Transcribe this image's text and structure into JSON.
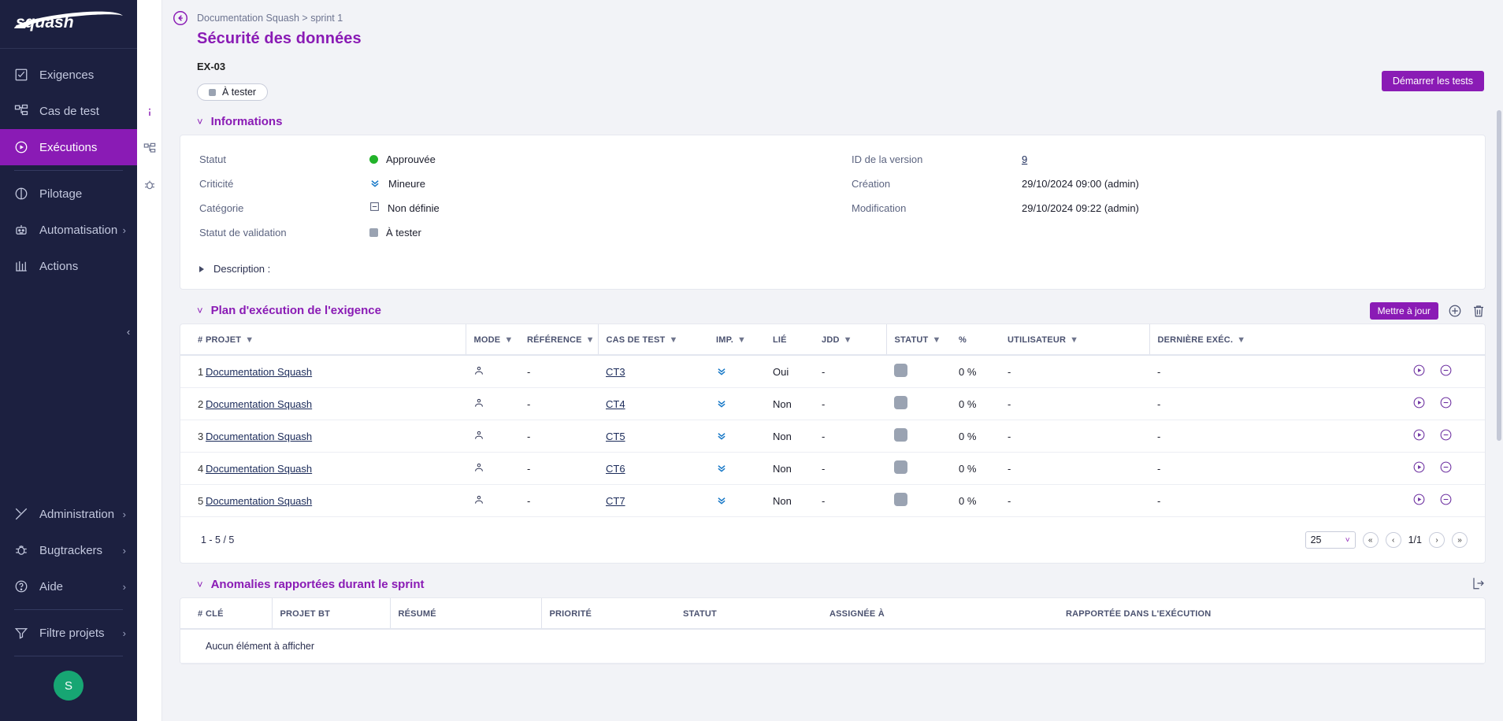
{
  "brand": {
    "name": "squash",
    "accent": "#8a1bb5",
    "sidebar_bg": "#1c2040"
  },
  "sidebar": {
    "items": [
      {
        "label": "Exigences",
        "icon": "checklist-icon",
        "active": false,
        "expandable": false
      },
      {
        "label": "Cas de test",
        "icon": "hierarchy-icon",
        "active": false,
        "expandable": false
      },
      {
        "label": "Exécutions",
        "icon": "play-circle-icon",
        "active": true,
        "expandable": false
      },
      {
        "label": "Pilotage",
        "icon": "pie-chart-icon",
        "active": false,
        "expandable": false
      },
      {
        "label": "Automatisation",
        "icon": "robot-icon",
        "active": false,
        "expandable": true
      },
      {
        "label": "Actions",
        "icon": "columns-icon",
        "active": false,
        "expandable": false
      }
    ],
    "bottom_items": [
      {
        "label": "Administration",
        "icon": "tools-icon",
        "expandable": true
      },
      {
        "label": "Bugtrackers",
        "icon": "bug-icon",
        "expandable": true
      },
      {
        "label": "Aide",
        "icon": "help-circle-icon",
        "expandable": true
      },
      {
        "label": "Filtre projets",
        "icon": "funnel-icon",
        "expandable": true
      }
    ],
    "avatar_initial": "S",
    "avatar_color": "#17a673"
  },
  "rail": {
    "items": [
      {
        "name": "info-icon",
        "selected": true
      },
      {
        "name": "tree-icon",
        "selected": false
      },
      {
        "name": "bug-icon",
        "selected": false
      }
    ]
  },
  "header": {
    "breadcrumb": "Documentation Squash > sprint 1",
    "title": "Sécurité des données",
    "reference": "EX-03",
    "status_pill": "À tester",
    "primary_button": "Démarrer les tests"
  },
  "informations": {
    "section_title": "Informations",
    "left": [
      {
        "label": "Statut",
        "value": "Approuvée",
        "marker": "dot-green"
      },
      {
        "label": "Criticité",
        "value": "Mineure",
        "marker": "chevrons-down"
      },
      {
        "label": "Catégorie",
        "value": "Non définie",
        "marker": "minus-box"
      },
      {
        "label": "Statut de validation",
        "value": "À tester",
        "marker": "grey-square"
      }
    ],
    "right": [
      {
        "label": "ID de la version",
        "value": "9",
        "link": true
      },
      {
        "label": "Création",
        "value": "29/10/2024 09:00 (admin)",
        "link": false
      },
      {
        "label": "Modification",
        "value": "29/10/2024 09:22 (admin)",
        "link": false
      }
    ],
    "description_label": "Description :"
  },
  "execution_plan": {
    "section_title": "Plan d'exécution de l'exigence",
    "update_button": "Mettre à jour",
    "columns": [
      "#",
      "PROJET",
      "MODE",
      "RÉFÉRENCE",
      "CAS DE TEST",
      "IMP.",
      "LIÉ",
      "JDD",
      "STATUT",
      "%",
      "UTILISATEUR",
      "DERNIÈRE EXÉC."
    ],
    "rows": [
      {
        "num": "1",
        "projet": "Documentation Squash",
        "mode": "user-icon",
        "reference": "-",
        "cas_de_test": "CT3",
        "imp": "chevrons-down",
        "lie": "Oui",
        "jdd": "-",
        "statut": "grey-square",
        "pct": "0 %",
        "utilisateur": "-",
        "derniere_exec": "-"
      },
      {
        "num": "2",
        "projet": "Documentation Squash",
        "mode": "user-icon",
        "reference": "-",
        "cas_de_test": "CT4",
        "imp": "chevrons-down",
        "lie": "Non",
        "jdd": "-",
        "statut": "grey-square",
        "pct": "0 %",
        "utilisateur": "-",
        "derniere_exec": "-"
      },
      {
        "num": "3",
        "projet": "Documentation Squash",
        "mode": "user-icon",
        "reference": "-",
        "cas_de_test": "CT5",
        "imp": "chevrons-down",
        "lie": "Non",
        "jdd": "-",
        "statut": "grey-square",
        "pct": "0 %",
        "utilisateur": "-",
        "derniere_exec": "-"
      },
      {
        "num": "4",
        "projet": "Documentation Squash",
        "mode": "user-icon",
        "reference": "-",
        "cas_de_test": "CT6",
        "imp": "chevrons-down",
        "lie": "Non",
        "jdd": "-",
        "statut": "grey-square",
        "pct": "0 %",
        "utilisateur": "-",
        "derniere_exec": "-"
      },
      {
        "num": "5",
        "projet": "Documentation Squash",
        "mode": "user-icon",
        "reference": "-",
        "cas_de_test": "CT7",
        "imp": "chevrons-down",
        "lie": "Non",
        "jdd": "-",
        "statut": "grey-square",
        "pct": "0 %",
        "utilisateur": "-",
        "derniere_exec": "-"
      }
    ],
    "footer": {
      "count": "1 - 5 / 5",
      "page_size": "25",
      "page_indicator": "1/1"
    }
  },
  "anomalies": {
    "section_title": "Anomalies rapportées durant le sprint",
    "columns": [
      "#",
      "CLÉ",
      "PROJET BT",
      "RÉSUMÉ",
      "PRIORITÉ",
      "STATUT",
      "ASSIGNÉE À",
      "RAPPORTÉE DANS L'EXÉCUTION"
    ],
    "empty_message": "Aucun élément à afficher"
  }
}
